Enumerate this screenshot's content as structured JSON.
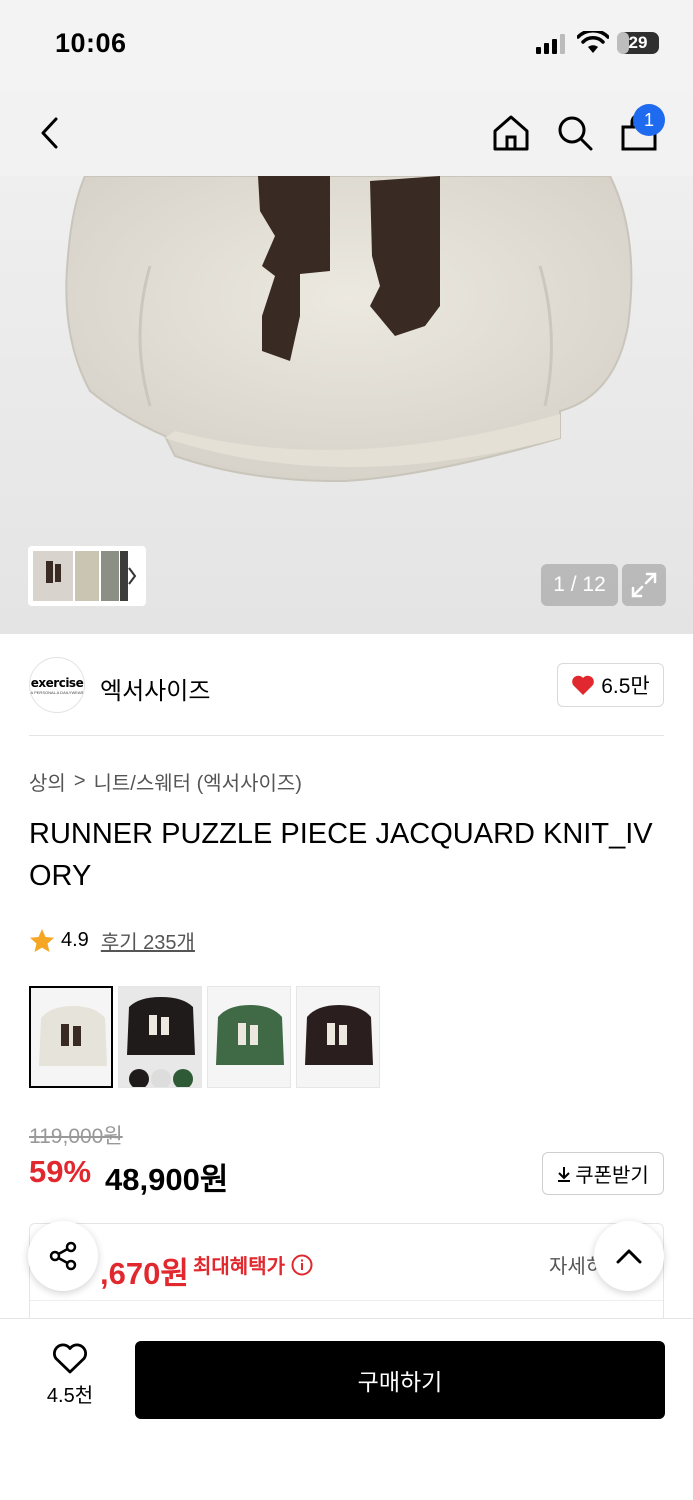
{
  "status_bar": {
    "time": "10:06",
    "battery": "29",
    "battery_level": 0.29
  },
  "nav": {
    "cart_count": "1",
    "icons": [
      "back-icon",
      "home-icon",
      "search-icon",
      "shopping-bag-icon"
    ]
  },
  "gallery": {
    "counter": "1 / 12"
  },
  "brand": {
    "logo_text": "exercise",
    "logo_sub": "A PERSONAL A DAILYWEAR",
    "name": "엑서사이즈",
    "likes": "6.5만"
  },
  "breadcrumb": {
    "level1": "상의",
    "separator": ">",
    "level2": "니트/스웨터 (엑서사이즈)"
  },
  "product": {
    "title": "RUNNER PUZZLE PIECE JACQUARD KNIT_IVORY"
  },
  "rating": {
    "score": "4.9",
    "reviews": "후기 235개"
  },
  "price": {
    "original": "119,000원",
    "discount": "59%",
    "sale": "48,900원",
    "coupon_label": "쿠폰받기"
  },
  "benefit": {
    "price": ",670원",
    "label": "최대혜택가",
    "detail": "자세히"
  },
  "bottom": {
    "wish_count": "4.5천",
    "buy_label": "구매하기"
  },
  "colors": {
    "accent_red": "#e0282e",
    "badge_blue": "#1e6bf0"
  }
}
